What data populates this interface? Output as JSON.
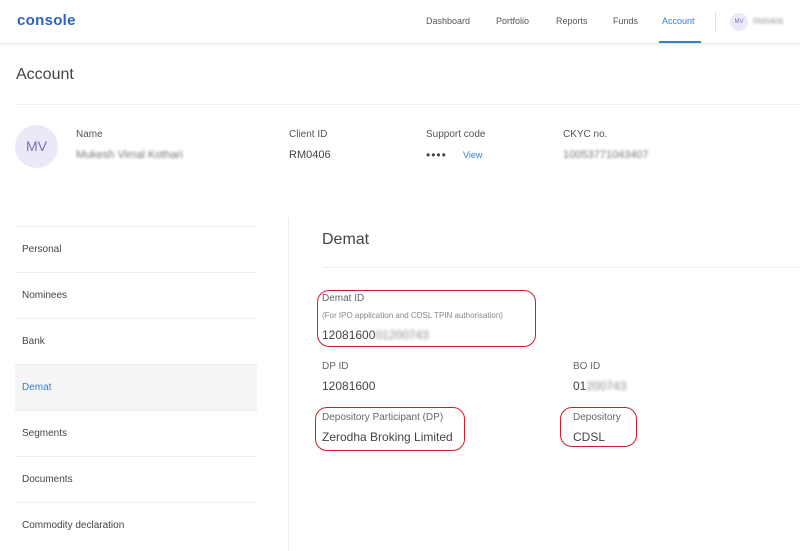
{
  "app": {
    "logo": "console"
  },
  "nav": {
    "items": [
      "Dashboard",
      "Portfolio",
      "Reports",
      "Funds",
      "Account"
    ],
    "active": "Account",
    "avatar_initials": "MV",
    "user_id": "RM0406"
  },
  "page": {
    "title": "Account"
  },
  "profile": {
    "initials": "MV",
    "name_label": "Name",
    "name_value": "Mukesh Vimal Kothari",
    "client_id_label": "Client ID",
    "client_id_value": "RM0406",
    "support_label": "Support code",
    "support_value": "••••",
    "support_link": "View",
    "ckyc_label": "CKYC no.",
    "ckyc_value": "10053771043407"
  },
  "sidebar": {
    "items": [
      {
        "label": "Personal"
      },
      {
        "label": "Nominees"
      },
      {
        "label": "Bank"
      },
      {
        "label": "Demat"
      },
      {
        "label": "Segments"
      },
      {
        "label": "Documents"
      },
      {
        "label": "Commodity declaration"
      }
    ],
    "active": "Demat"
  },
  "demat": {
    "title": "Demat",
    "demat_id_label": "Demat ID",
    "demat_id_note": "(For IPO application and CDSL TPIN authorisation)",
    "demat_id_prefix": "12081600",
    "demat_id_masked": "01200743",
    "dp_id_label": "DP ID",
    "dp_id_value": "12081600",
    "bo_id_label": "BO ID",
    "bo_id_prefix": "01",
    "bo_id_masked": "200743",
    "dp_label": "Depository Participant (DP)",
    "dp_value": "Zerodha Broking Limited",
    "depository_label": "Depository",
    "depository_value": "CDSL"
  },
  "colors": {
    "accent": "#387ed1",
    "annotation": "#cc1f2b",
    "avatar_bg": "#ece8f8"
  }
}
